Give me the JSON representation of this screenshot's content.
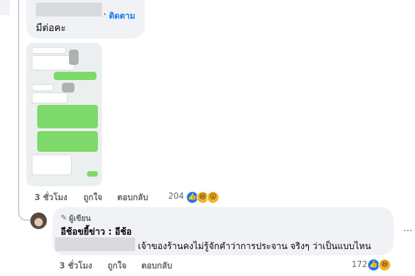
{
  "comment1": {
    "follow": "ติดตาม",
    "text": "มีต่อคะ",
    "time": "3 ชั่วโมง",
    "like": "ถูกใจ",
    "reply": "ตอบกลับ",
    "reaction_count": "204"
  },
  "reply1": {
    "author_badge": "ผู้เขียน",
    "author_name": "อีช้อขยี้ข่าว : อีช้อ",
    "text": "เจ้าของร้านคงไม่รู้จักคำว่าการประจาน จริงๆ ว่าเป็นแบบไหน",
    "time": "3 ชั่วโมง",
    "like": "ถูกใจ",
    "reply": "ตอบกลับ",
    "reaction_count": "172",
    "more": "···"
  },
  "icons": {
    "like": "👍",
    "haha": "😆",
    "wow": "😮",
    "pen": "✎"
  },
  "colors": {
    "link": "#1877f2",
    "bubble": "#f0f2f5",
    "muted": "#65676b",
    "chat_green": "#7dd96a"
  }
}
